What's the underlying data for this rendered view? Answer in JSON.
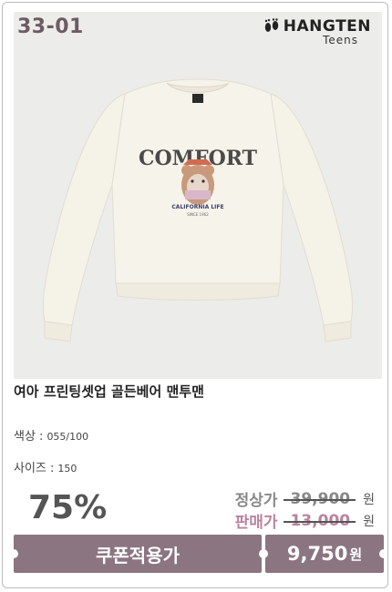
{
  "product": {
    "code": "33-01",
    "brand_name": "HANGTEN",
    "brand_sub": "Teens",
    "print_text_top": "COMFORT",
    "print_text_bottom": "CALIFORNIA LIFE",
    "print_text_tiny": "SINCE 1962",
    "title": "여아 프린팅셋업 골든베어 맨투맨",
    "color_label": "색상 :",
    "color_value": "055/100",
    "size_label": "사이즈 :",
    "size_value": "150",
    "discount": "75%"
  },
  "pricing": {
    "regular_label": "정상가",
    "regular_price": "39,900",
    "sale_label": "판매가",
    "sale_price": "13,000",
    "currency": "원",
    "coupon_label": "쿠폰적용가",
    "final_price": "9,750",
    "final_currency": "원"
  },
  "colors": {
    "accent": "#8b7580",
    "sale_pink": "#b9839e",
    "photo_bg": "#ececea",
    "sweater": "#f5f2e8"
  },
  "icons": {
    "brand_logo": "footprints-icon"
  }
}
